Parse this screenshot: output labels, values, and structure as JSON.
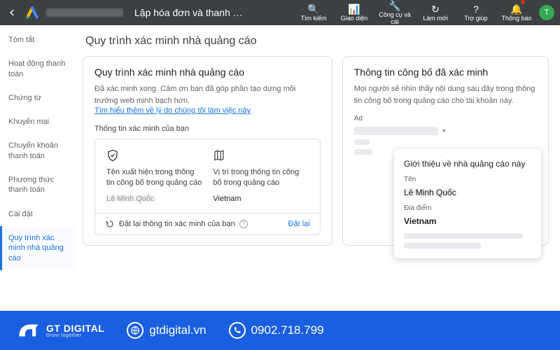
{
  "header": {
    "title": "Lập hóa đơn và thanh …",
    "icons": [
      {
        "id": "search",
        "label": "Tìm kiếm"
      },
      {
        "id": "reports",
        "label": "Giao diện"
      },
      {
        "id": "tools",
        "label": "Công cụ và cài"
      },
      {
        "id": "refresh",
        "label": "Làm mới"
      },
      {
        "id": "help",
        "label": "Trợ giúp"
      },
      {
        "id": "notifications",
        "label": "Thông báo"
      }
    ],
    "avatar_letter": "T"
  },
  "sidebar": {
    "items": [
      "Tóm tắt",
      "Hoạt động thanh toán",
      "Chứng từ",
      "Khuyến mại",
      "Chuyển khoản thanh toán",
      "Phương thức thanh toán",
      "Cài đặt",
      "Quy trình xác minh nhà quảng cáo"
    ],
    "active_index": 7
  },
  "page": {
    "title": "Quy trình xác minh nhà quảng cáo"
  },
  "left_card": {
    "heading": "Quy trình xác minh nhà quảng cáo",
    "body": "Đã xác minh xong. Cảm ơn bạn đã góp phần tạo dựng môi trường web minh bạch hơn.",
    "link": "Tìm hiểu thêm về lý do chúng tôi làm việc này",
    "sub_title": "Thông tin xác minh của bạn",
    "col1_label": "Tên xuất hiện trong thông tin công bố trong quảng cáo",
    "col1_value": "Lê Minh Quốc",
    "col2_label": "Vị trí trong thông tin công bố trong quảng cáo",
    "col2_value": "Vietnam",
    "reset_label": "Đặt lại thông tin xác minh của bạn",
    "reset_action": "Đặt lại"
  },
  "right_card": {
    "heading": "Thông tin công bố đã xác minh",
    "body": "Mọi người sẽ nhìn thấy nội dung sau đây trong thông tin công bố trong quảng cáo cho tài khoản này.",
    "ad_label": "Ad"
  },
  "popover": {
    "heading": "Giới thiệu về nhà quảng cáo này",
    "name_label": "Tên",
    "name_value": "Lê Minh Quốc",
    "loc_label": "Địa điểm",
    "loc_value": "Vietnam"
  },
  "footer": {
    "brand_big": "GT DIGITAL",
    "brand_small": "Grow together",
    "website": "gtdigital.vn",
    "phone": "0902.718.799"
  }
}
